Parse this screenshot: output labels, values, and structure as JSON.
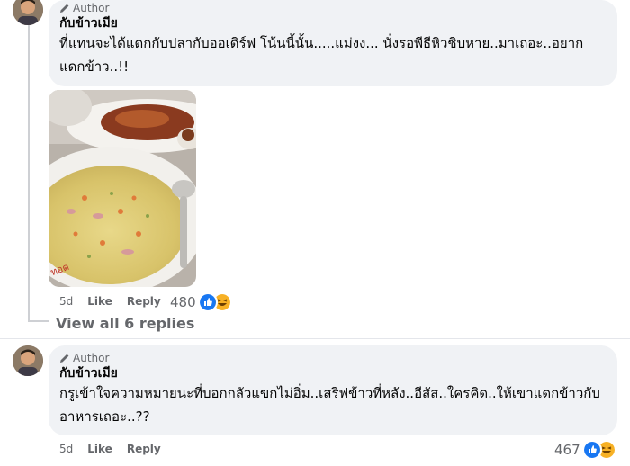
{
  "comments": [
    {
      "author_badge": "Author",
      "name": "กับข้าวเมีย",
      "text": "ที่แทนจะได้แดกกับปลากับออเดิร์ฟ โน้นนี้นั้น.....แม่งง... นั่งรอพีธีหิวชิบหาย..มาเถอะ..อยากแดกข้าว..!!",
      "time": "5d",
      "like": "Like",
      "reply": "Reply",
      "reaction_count": "480"
    },
    {
      "author_badge": "Author",
      "name": "กับข้าวเมีย",
      "text": "กรูเข้าใจความหมายนะที่บอกกลัวแขกไม่อิ่ม..เสริฟข้าวที่หลัง..อีสัส..ใครคิด..ให้เขาแดกข้าวกับอาหารเถอะ..??",
      "time": "5d",
      "like": "Like",
      "reply": "Reply",
      "reaction_count": "467"
    }
  ],
  "view_replies": "View all 6 replies",
  "icons": [
    "pencil-icon",
    "like-reaction-icon",
    "haha-reaction-icon"
  ],
  "colors": {
    "bubble": "#f0f2f5",
    "like_blue": "#1877f2",
    "haha_yellow": "#f7b125",
    "muted": "#65676b"
  }
}
